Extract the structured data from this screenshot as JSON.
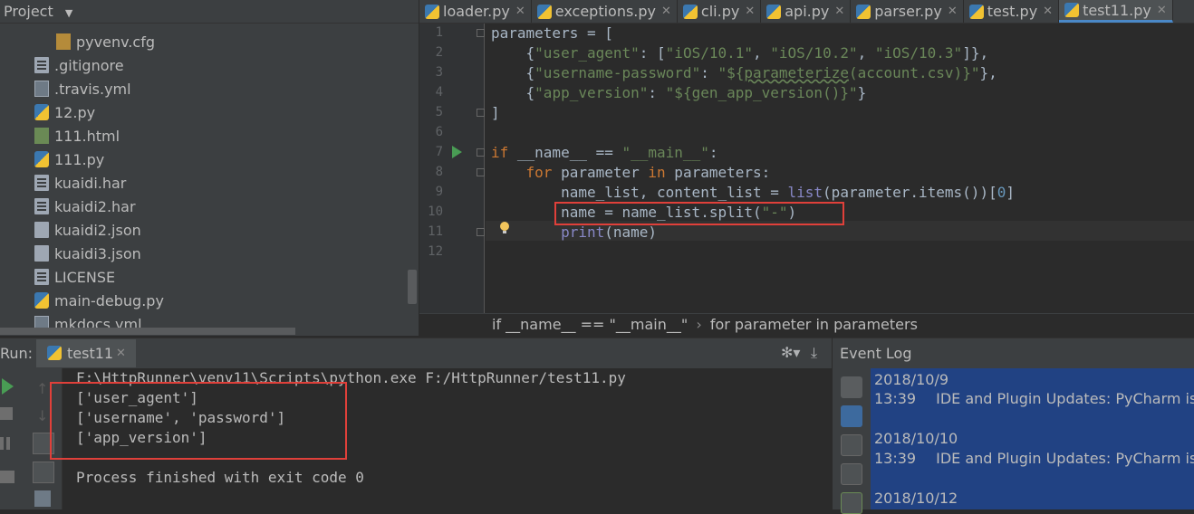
{
  "project": {
    "title": "Project",
    "dropdown_icon": "caret-down-icon",
    "tools_icons": [
      "target-icon",
      "collapse-icon",
      "gear-icon",
      "hide-icon"
    ],
    "files": [
      {
        "name": "pyvenv.cfg",
        "icon": "cfg-file-icon"
      },
      {
        "name": ".gitignore",
        "icon": "text-file-icon"
      },
      {
        "name": ".travis.yml",
        "icon": "yml-file-icon"
      },
      {
        "name": "12.py",
        "icon": "python-file-icon"
      },
      {
        "name": "111.html",
        "icon": "html-file-icon"
      },
      {
        "name": "111.py",
        "icon": "python-file-icon"
      },
      {
        "name": "kuaidi.har",
        "icon": "text-file-icon"
      },
      {
        "name": "kuaidi2.har",
        "icon": "text-file-icon"
      },
      {
        "name": "kuaidi2.json",
        "icon": "json-file-icon"
      },
      {
        "name": "kuaidi3.json",
        "icon": "json-file-icon"
      },
      {
        "name": "LICENSE",
        "icon": "text-file-icon"
      },
      {
        "name": "main-debug.py",
        "icon": "python-file-icon"
      },
      {
        "name": "mkdocs.yml",
        "icon": "yml-file-icon"
      }
    ]
  },
  "tabs": [
    {
      "label": "loader.py",
      "active": false
    },
    {
      "label": "exceptions.py",
      "active": false
    },
    {
      "label": "cli.py",
      "active": false
    },
    {
      "label": "api.py",
      "active": false
    },
    {
      "label": "parser.py",
      "active": false
    },
    {
      "label": "test.py",
      "active": false
    },
    {
      "label": "test11.py",
      "active": true
    }
  ],
  "editor": {
    "line_numbers": [
      "1",
      "2",
      "3",
      "4",
      "5",
      "6",
      "7",
      "8",
      "9",
      "10",
      "11",
      "12"
    ],
    "lines": [
      "parameters = [",
      "    {\"user_agent\": [\"iOS/10.1\", \"iOS/10.2\", \"iOS/10.3\"]},",
      "    {\"username-password\": \"${parameterize(account.csv)}\"},",
      "    {\"app_version\": \"${gen_app_version()}\"}",
      "]",
      "",
      "if __name__ == \"__main__\":",
      "    for parameter in parameters:",
      "        name_list, content_list = list(parameter.items())[0]",
      "        name = name_list.split(\"-\")",
      "        print(name)",
      ""
    ]
  },
  "breadcrumb": {
    "items": [
      "if __name__ == \"__main__\"",
      "for parameter in parameters"
    ],
    "separator": "›"
  },
  "run": {
    "label": "Run:",
    "tab": "test11",
    "console": [
      "F:\\HttpRunner\\venv11\\Scripts\\python.exe F:/HttpRunner/test11.py",
      "['user_agent']",
      "['username', 'password']",
      "['app_version']",
      "",
      "Process finished with exit code 0"
    ]
  },
  "event_log": {
    "title": "Event Log",
    "entries": [
      {
        "date": "2018/10/9",
        "time": "13:39",
        "text": "IDE and Plugin Updates: PyCharm is re"
      },
      {
        "date": "2018/10/10",
        "time": "13:39",
        "text": "IDE and Plugin Updates: PyCharm is re"
      },
      {
        "date": "2018/10/12",
        "time": "",
        "text": ""
      }
    ]
  },
  "colors": {
    "highlight_box": "#e0403a",
    "keyword": "#cc7832",
    "string": "#6a8759",
    "event_selected": "#214283"
  }
}
